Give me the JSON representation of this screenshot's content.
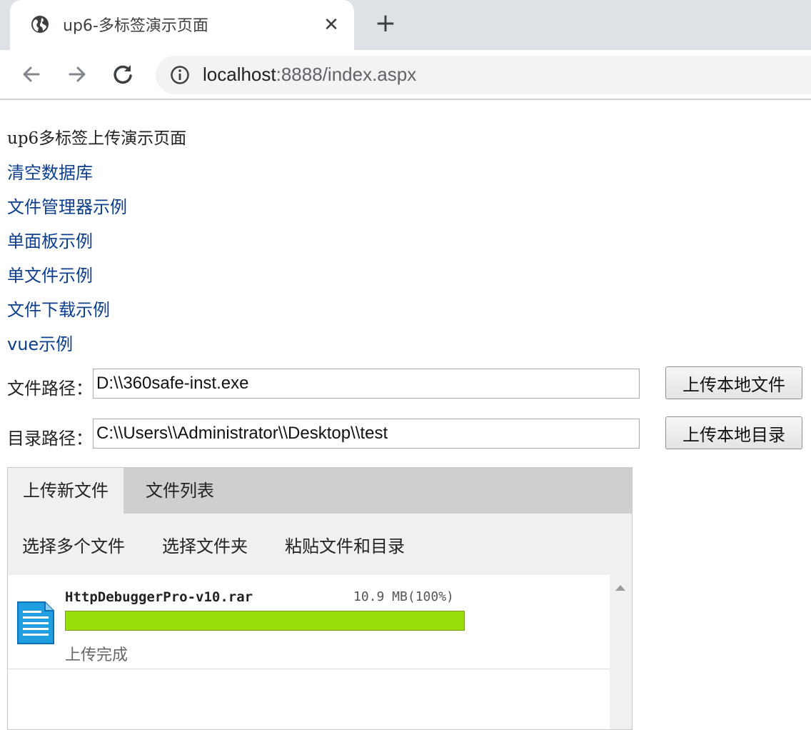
{
  "browser": {
    "tab_title": "up6-多标签演示页面",
    "tab_close": "✕",
    "new_tab": "+",
    "url_host": "localhost",
    "url_rest": ":8888/index.aspx"
  },
  "page": {
    "heading": "up6多标签上传演示页面",
    "links": [
      "清空数据库",
      "文件管理器示例",
      "单面板示例",
      "单文件示例",
      "文件下载示例",
      "vue示例"
    ]
  },
  "file_path": {
    "label": "文件路径：",
    "value": "D:\\\\360safe-inst.exe",
    "button": "上传本地文件"
  },
  "dir_path": {
    "label": "目录路径：",
    "value": "C:\\\\Users\\\\Administrator\\\\Desktop\\\\test",
    "button": "上传本地目录"
  },
  "uploader": {
    "tabs": [
      "上传新文件",
      "文件列表"
    ],
    "actions": [
      "选择多个文件",
      "选择文件夹",
      "粘贴文件和目录"
    ],
    "file": {
      "name": "HttpDebuggerPro-v10.rar",
      "size": "10.9 MB(100%)",
      "progress": 1.0,
      "status": "上传完成"
    },
    "progress_color": "#99de0a"
  },
  "colors": {
    "link": "#0b3f8e",
    "tabstrip": "#dee1e6"
  }
}
